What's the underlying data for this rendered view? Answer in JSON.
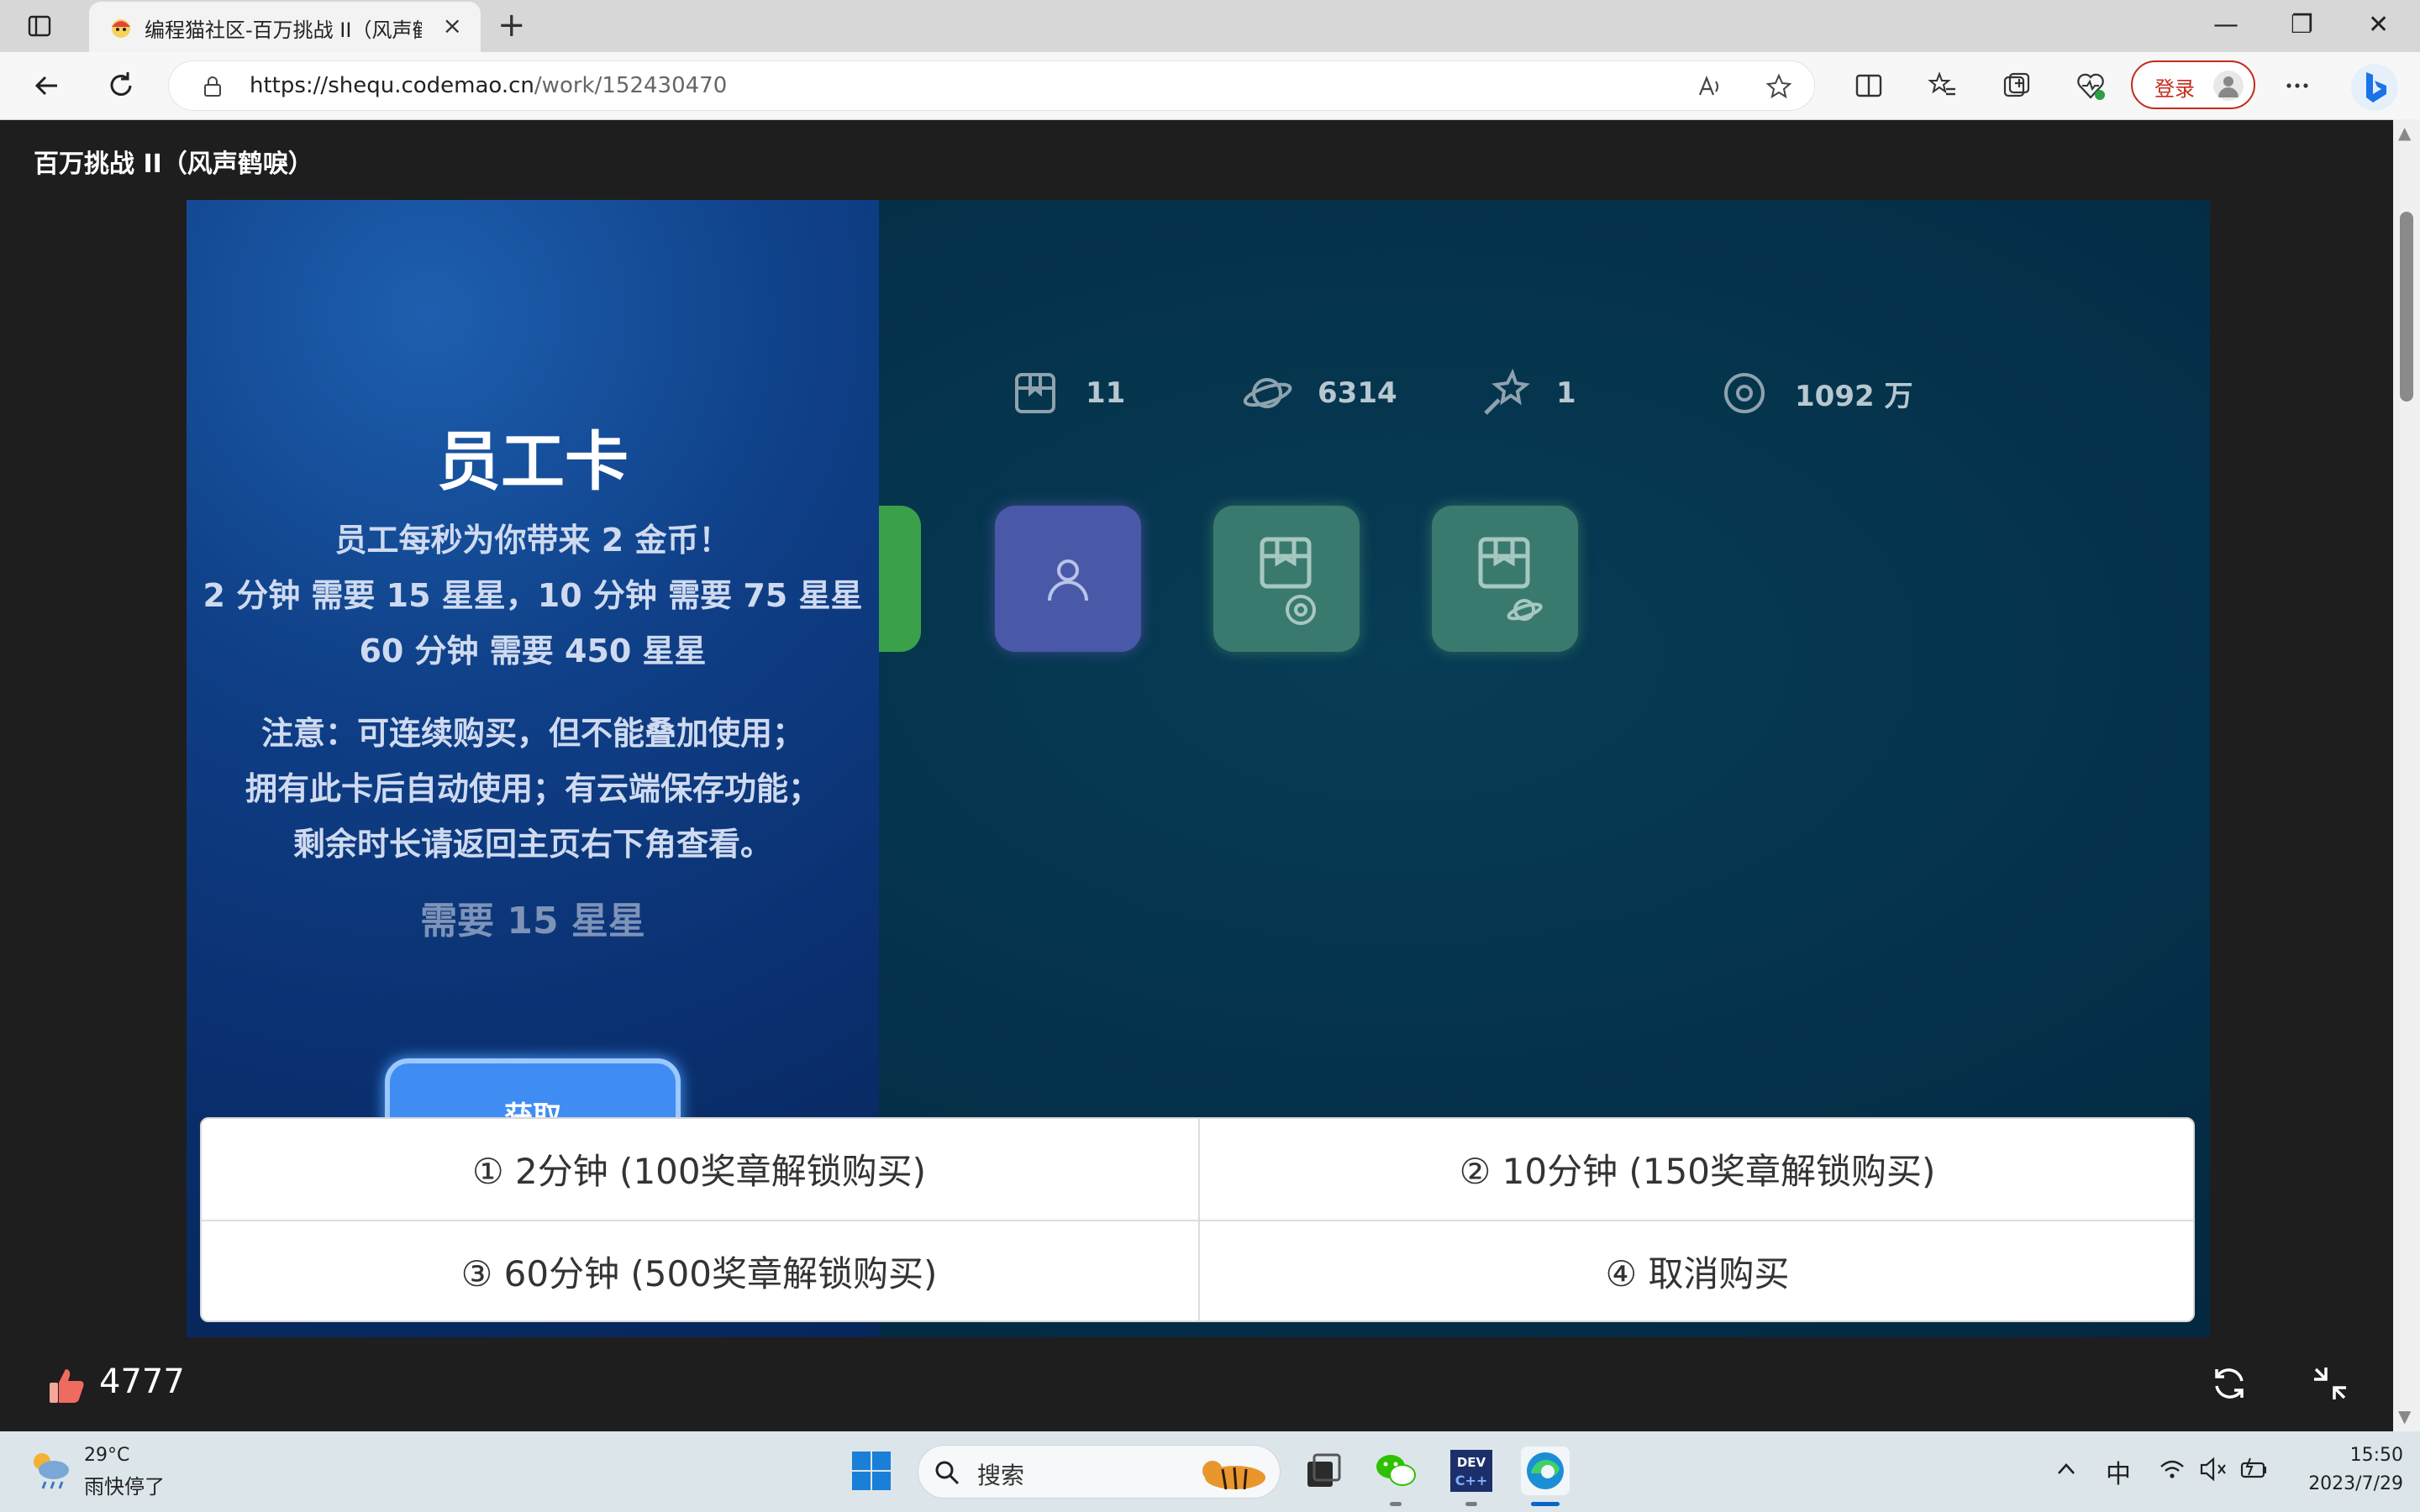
{
  "browser": {
    "tab_title": "编程猫社区-百万挑战 II（风声鹤唳）",
    "tab_close": "×",
    "new_tab": "+",
    "url_scheme_host": "https://shequ.codemao.cn",
    "url_path": "/work/152430470",
    "login_label": "登录",
    "window_controls": {
      "minimize": "—",
      "restore": "❐",
      "close": "✕"
    }
  },
  "page": {
    "title": "百万挑战 II（风声鹤唳）"
  },
  "game": {
    "stats": [
      {
        "icon": "box-icon",
        "value": "11"
      },
      {
        "icon": "planet-icon",
        "value": "6314"
      },
      {
        "icon": "magic-wand-icon",
        "value": "1"
      },
      {
        "icon": "coin-icon",
        "value": "1092 万"
      }
    ],
    "card": {
      "title": "员工卡",
      "line1": "员工每秒为你带来 2 金币！",
      "line2": "2 分钟 需要 15 星星，10 分钟 需要 75 星星",
      "line3": "60 分钟 需要 450 星星",
      "note1": "注意：可连续购买，但不能叠加使用；",
      "note2": "拥有此卡后自动使用；有云端保存功能；",
      "note3": "剩余时长请返回主页右下角查看。",
      "cost": "需要 15 星星",
      "button": "获取"
    },
    "choices": [
      "① 2分钟 (100奖章解锁购买)",
      "② 10分钟 (150奖章解锁购买)",
      "③ 60分钟 (500奖章解锁购买)",
      "④ 取消购买"
    ]
  },
  "bottom_bar": {
    "like_count": "4777"
  },
  "taskbar": {
    "weather_temp": "29°C",
    "weather_desc": "雨快停了",
    "search_label": "搜索",
    "ime": "中",
    "time": "15:50",
    "date": "2023/7/29"
  },
  "colors": {
    "stage_bg": "#042e47",
    "panel_bg": "#0f3f87",
    "tile_green": "#3aa14a",
    "tile_purple": "#4a58a8",
    "tile_teal": "#3a7a6e",
    "login_red": "#c42b1c"
  }
}
